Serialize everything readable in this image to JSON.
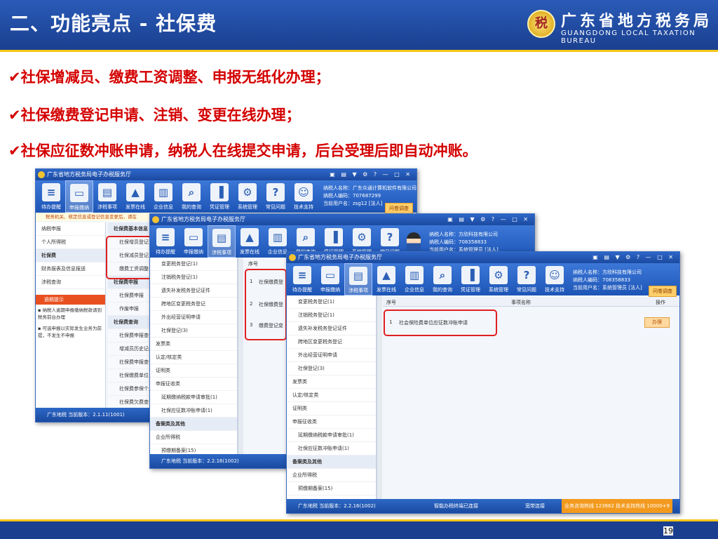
{
  "slide": {
    "title": "二、功能亮点 - 社保费",
    "bureau_cn": "广东省地方税务局",
    "bureau_en": "GUANGDONG LOCAL TAXATION BUREAU",
    "page": "19"
  },
  "points": [
    "✔社保增减员、缴费工资调整、申报无纸化办理；",
    "✔社保缴费登记申请、注销、变更在线办理；",
    "✔社保应征数冲账申请，纳税人在线提交申请，后台受理后即自动冲账。"
  ],
  "app": {
    "title": "广东省地方税务局电子办税服务厅",
    "window_controls": "▣ ▤ ▼ ⚙ ? — □ ✕",
    "ribbon": [
      "待办提醒",
      "申报缴纳",
      "涉税事项",
      "发票在线",
      "企业信息",
      "我的查询",
      "凭证管理",
      "系统管理",
      "常见问题",
      "技术支持"
    ],
    "survey": "问卷调查"
  },
  "win1": {
    "user": [
      "纳税人名称：广东众通计算机软件有限公司",
      "纳税人编码：707687299",
      "当前用户名：zsg12 [法人]"
    ],
    "notice": "税务机关、核定信息或登记信息变更后，请在",
    "side": [
      "纳税申报",
      "个人所得税",
      "社保费",
      "财务报表及信息报送",
      "涉税查询"
    ],
    "alert_title": "逾期提示",
    "alerts": [
      "▪ 纳税人逾期申报缴纳税款请到税务前台办理",
      "▪ 可选申报以实际发生业务为前提，不发生不申报"
    ],
    "col_head": "社保费基本信息",
    "items": [
      "社保增员登记",
      "社保减员登记",
      "缴费工资调整",
      "社保费申报",
      "社保费申报",
      "作废申报",
      "社保费查询",
      "社保费申报查询",
      "增减员历史记录",
      "社保费申报查询",
      "社保缴费单位",
      "社保费参保个人",
      "社保费欠费查询",
      "社保费缴费信息"
    ],
    "groups": {
      "a": "社保费申报",
      "b": "社保费查询"
    },
    "status": "广东地税   当前版本：2.1.11(1001)"
  },
  "win2": {
    "user": [
      "纳税人名称：方欣科技有限公司",
      "纳税人编码：708358833",
      "当前用户名：系统管理员 [法人]"
    ],
    "tree": [
      "变更税务登记(1)",
      "注销税务登记(1)",
      "遗失补发税务登记证件",
      "跨地区变更税务登记",
      "外出经营证明申请",
      "社保登记(3)",
      "发票类",
      "认定/核定类",
      "证明类",
      "申报征收类",
      "延期缴纳税款申请审批(1)",
      "社保应征数冲账申请(1)",
      "备案类及其他",
      "企业所得税",
      "预缴期备案(15)"
    ],
    "col": "序号",
    "rows": [
      {
        "n": "1",
        "t": "社保缴费登"
      },
      {
        "n": "2",
        "t": "社保缴费登"
      },
      {
        "n": "3",
        "t": "缴费登记变"
      }
    ],
    "status": "广东地税   当前版本：2.2.16(1002)"
  },
  "win3": {
    "user": [
      "纳税人名称：方欣科技有限公司",
      "纳税人编码：708358833",
      "当前用户名：系统管理员 [法人]"
    ],
    "tree": [
      "变更税务登记(1)",
      "注销税务登记(1)",
      "遗失补发税务登记证件",
      "跨地区变更税务登记",
      "外出经营证明申请",
      "社保登记(3)",
      "发票类",
      "认定/核定类",
      "证明类",
      "申报征收类",
      "延期缴纳税款申请审批(1)",
      "社保应征数冲账申请(1)",
      "备案类及其他",
      "企业所得税",
      "预缴期备案(15)"
    ],
    "cols": {
      "seq": "序号",
      "name": "事项名称",
      "op": "操作"
    },
    "row": {
      "n": "1",
      "name": "社会保险费单位应征数冲账申请",
      "btn": "办理"
    },
    "status": "广东地税   当前版本：2.2.16(1002)",
    "smart": "智能办税终端已连接",
    "net": "宽带连接",
    "hotline": "业务咨询热线 123662  技术支持热线 10000+9"
  },
  "colors": {
    "red": "#d40000",
    "blue": "#1a3f8f",
    "gold": "#f5c518"
  }
}
